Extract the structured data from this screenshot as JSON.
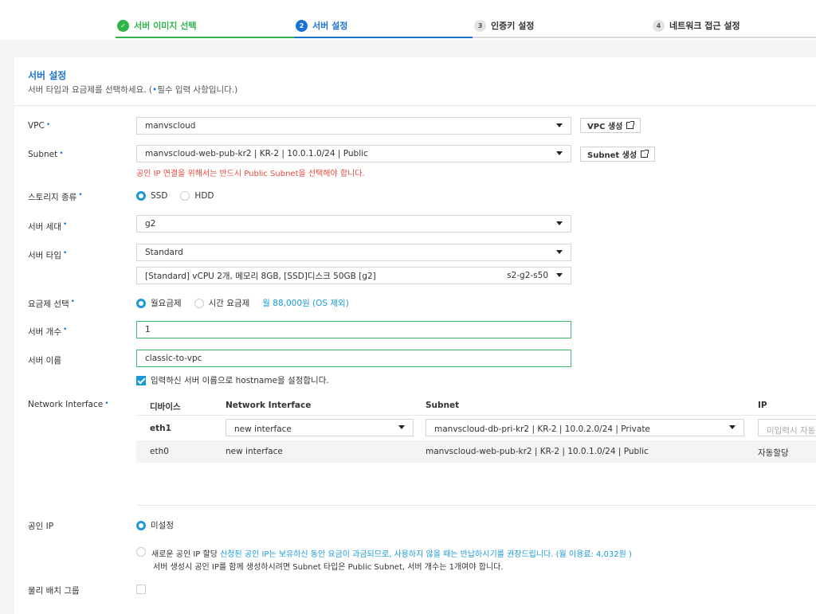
{
  "steps": [
    {
      "num": "✓",
      "label": "서버 이미지 선택",
      "state": "done"
    },
    {
      "num": "2",
      "label": "서버 설정",
      "state": "active"
    },
    {
      "num": "3",
      "label": "인증키 설정",
      "state": "todo"
    },
    {
      "num": "4",
      "label": "네트워크 접근 설정",
      "state": "todo"
    }
  ],
  "section": {
    "title": "서버 설정",
    "desc_prefix": "서버 타입과 요금제를 선택하세요. (",
    "desc_dot": "•",
    "desc_suffix": "필수 입력 사항입니다.)"
  },
  "required_mark": "•",
  "vpc": {
    "label": "VPC",
    "value": "manvscloud",
    "button": "VPC 생성"
  },
  "subnet": {
    "label": "Subnet",
    "value": "manvscloud-web-pub-kr2 | KR-2 | 10.0.1.0/24 | Public",
    "button": "Subnet 생성",
    "error": "공인 IP 연결을 위해서는 반드시 Public Subnet을 선택해야 합니다."
  },
  "storage": {
    "label": "스토리지 종류",
    "options": [
      "SSD",
      "HDD"
    ],
    "selected": "SSD"
  },
  "generation": {
    "label": "서버 세대",
    "value": "g2"
  },
  "server_type": {
    "label": "서버 타입",
    "value": "Standard",
    "spec": "[Standard] vCPU 2개, 메모리 8GB, [SSD]디스크 50GB [g2]",
    "spec_code": "s2-g2-s50"
  },
  "pricing": {
    "label": "요금제 선택",
    "options": [
      "월요금제",
      "시간 요금제"
    ],
    "selected": "월요금제",
    "price": "월 88,000원 (OS 제외)"
  },
  "count": {
    "label": "서버 개수",
    "value": "1"
  },
  "name": {
    "label": "서버 이름",
    "value": "classic-to-vpc",
    "hostname_check": "입력하신 서버 이름으로 hostname을 설정합니다."
  },
  "ni": {
    "label": "Network Interface",
    "headers": {
      "device": "디바이스",
      "ni": "Network Interface",
      "subnet": "Subnet",
      "ip": "IP"
    },
    "rows": [
      {
        "device": "eth1",
        "ni": "new interface",
        "subnet": "manvscloud-db-pri-kr2 | KR-2 | 10.0.2.0/24 | Private",
        "ip_placeholder": "미입력시 자동"
      },
      {
        "device": "eth0",
        "ni": "new interface",
        "subnet": "manvscloud-web-pub-kr2 | KR-2 | 10.0.1.0/24 | Public",
        "ip": "자동할당"
      }
    ]
  },
  "public_ip": {
    "label": "공인 IP",
    "opt1": "미설정",
    "opt2": "새로운 공인 IP 할당",
    "notice_blue": "신청된 공인 IP는 보유하신 동안 요금이 과금되므로, 사용하지 않을 때는 반납하시기를 권장드립니다. (월 이용료: 4,032원 )",
    "notice_red": "서버 생성시 공인 IP를 함께 생성하시려면 Subnet 타입은 Public Subnet, 서버 개수는 1개여야 합니다."
  },
  "placement": {
    "label": "물리 배치 그룹"
  },
  "colors": {
    "primary": "#1a73d4",
    "done": "#2fb54a",
    "accent": "#1a9bd7",
    "error": "#e84a3c"
  }
}
